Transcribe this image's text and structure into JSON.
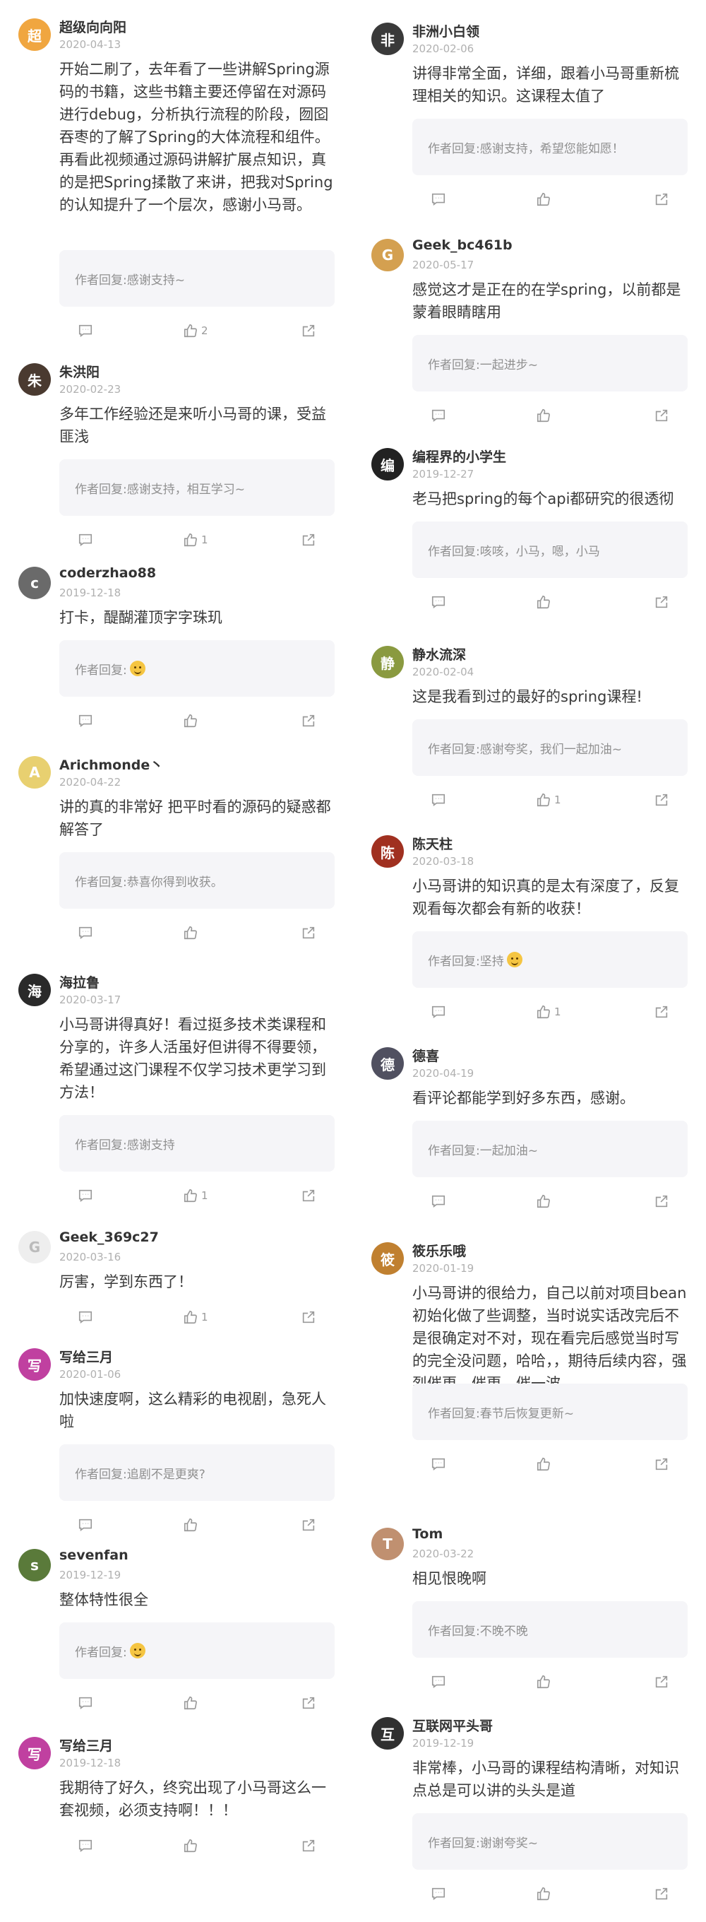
{
  "reply_prefix": "作者回复: ",
  "left_comments": [
    {
      "name": "超级向向阳",
      "date": "2020-04-13",
      "text": "开始二刷了，去年看了一些讲解Spring源码的书籍，这些书籍主要还停留在对源码进行debug，分析执行流程的阶段，囫囵吞枣的了解了Spring的大体流程和组件。再看此视频通过源码讲解扩展点知识，真的是把Spring揉散了来讲，把我对Spring的认知提升了一个层次，感谢小马哥。",
      "reply": "感谢支持~",
      "likes": "2",
      "avatar_color": "#f0a640",
      "avatar_letter": "超"
    },
    {
      "name": "朱洪阳",
      "date": "2020-02-23",
      "text": "多年工作经验还是来听小马哥的课，受益匪浅",
      "reply": "感谢支持，相互学习~",
      "likes": "1",
      "avatar_color": "#4a3a30",
      "avatar_letter": "朱"
    },
    {
      "name": "coderzhao88",
      "date": "2019-12-18",
      "text": "打卡，醍醐灌顶字字珠玑",
      "reply": "",
      "reply_emoji": true,
      "likes": "",
      "avatar_color": "#6a6a6a",
      "avatar_letter": "c"
    },
    {
      "name": "Arichmonde丶",
      "date": "2020-04-22",
      "text": "讲的真的非常好 把平时看的源码的疑惑都解答了",
      "reply": "恭喜你得到收获。",
      "likes": "",
      "avatar_color": "#e8d070",
      "avatar_letter": "A"
    },
    {
      "name": "海拉鲁",
      "date": "2020-03-17",
      "text": "小马哥讲得真好！看过挺多技术类课程和分享的，许多人活虽好但讲得不得要领，希望通过这门课程不仅学习技术更学习到方法！",
      "reply": "感谢支持",
      "likes": "1",
      "avatar_color": "#2a2a2a",
      "avatar_letter": "海"
    },
    {
      "name": "Geek_369c27",
      "date": "2020-03-16",
      "text": "厉害，学到东西了！",
      "reply": "",
      "no_reply": true,
      "likes": "1",
      "avatar_color": "#eeeeee",
      "avatar_letter": "G"
    },
    {
      "name": "写给三月",
      "date": "2020-01-06",
      "text": "加快速度啊，这么精彩的电视剧，急死人啦",
      "reply": "追剧不是更爽?",
      "likes": "",
      "avatar_color": "#c040a0",
      "avatar_letter": "写"
    },
    {
      "name": "sevenfan",
      "date": "2019-12-19",
      "text": "整体特性很全",
      "reply": "",
      "reply_emoji": true,
      "likes": "",
      "avatar_color": "#5a7a3a",
      "avatar_letter": "s"
    },
    {
      "name": "写给三月",
      "date": "2019-12-18",
      "text": "我期待了好久，终究出现了小马哥这么一套视频，必须支持啊！！！",
      "reply": "",
      "no_reply": true,
      "likes": "",
      "avatar_color": "#c040a0",
      "avatar_letter": "写"
    }
  ],
  "right_comments": [
    {
      "name": "非洲小白领",
      "date": "2020-02-06",
      "text": "讲得非常全面，详细，跟着小马哥重新梳理相关的知识。这课程太值了",
      "reply": "感谢支持，希望您能如愿！",
      "likes": "",
      "avatar_color": "#3a3a3a",
      "avatar_letter": "非"
    },
    {
      "name": "Geek_bc461b",
      "date": "2020-05-17",
      "text": "感觉这才是正在的在学spring，以前都是蒙着眼睛瞎用",
      "reply": "一起进步~",
      "likes": "",
      "avatar_color": "#d4a050",
      "avatar_letter": "G"
    },
    {
      "name": "编程界的小学生",
      "date": "2019-12-27",
      "text": "老马把spring的每个api都研究的很透彻",
      "reply": "咳咳，小马，嗯，小马",
      "likes": "",
      "avatar_color": "#222222",
      "avatar_letter": "编"
    },
    {
      "name": "静水流深",
      "date": "2020-02-04",
      "text": "这是我看到过的最好的spring课程!",
      "reply": "感谢夸奖，我们一起加油~",
      "likes": "1",
      "avatar_color": "#8a9a40",
      "avatar_letter": "静"
    },
    {
      "name": "陈天柱",
      "date": "2020-03-18",
      "text": "小马哥讲的知识真的是太有深度了，反复观看每次都会有新的收获！",
      "reply": "坚持",
      "reply_emoji": true,
      "likes": "1",
      "avatar_color": "#a03020",
      "avatar_letter": "陈"
    },
    {
      "name": "德喜",
      "date": "2020-04-19",
      "text": "看评论都能学到好多东西，感谢。",
      "reply": "一起加油~",
      "likes": "",
      "avatar_color": "#505060",
      "avatar_letter": "德"
    },
    {
      "name": "筱乐乐哦",
      "date": "2020-01-19",
      "text": "小马哥讲的很给力，自己以前对项目bean初始化做了些调整，当时说实话改完后不是很确定对不对，现在看完后感觉当时写的完全没问题，哈哈，，期待后续内容，强烈催更，催更，催一波",
      "reply": "春节后恢复更新~",
      "likes": "",
      "avatar_color": "#c08030",
      "avatar_letter": "筱"
    },
    {
      "name": "Tom",
      "date": "2020-03-22",
      "text": "相见恨晚啊",
      "reply": "不晚不晚",
      "likes": "",
      "avatar_color": "#c09070",
      "avatar_letter": "T"
    },
    {
      "name": "互联网平头哥",
      "date": "2019-12-19",
      "text": "非常棒，小马哥的课程结构清晰，对知识点总是可以讲的头头是道",
      "reply": "谢谢夸奖~",
      "likes": "",
      "avatar_color": "#303030",
      "avatar_letter": "互"
    }
  ]
}
